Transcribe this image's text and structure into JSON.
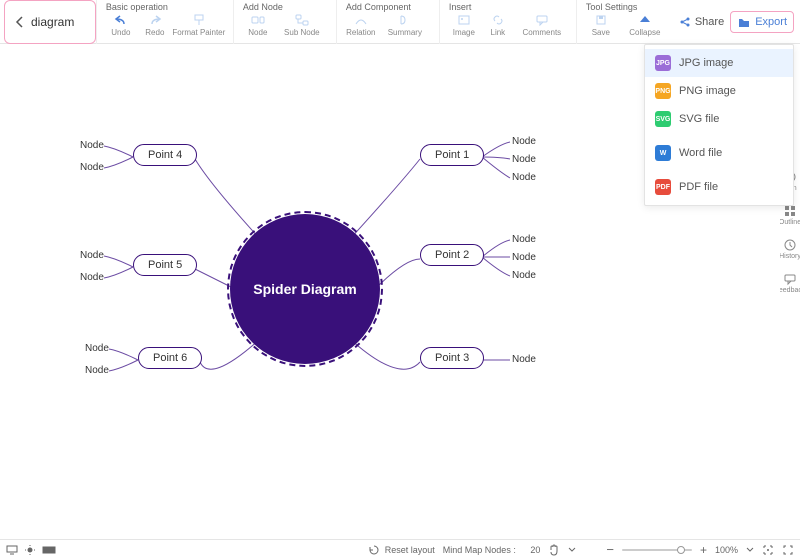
{
  "header": {
    "title": "diagram",
    "groups": {
      "basic": {
        "label": "Basic operation",
        "items": {
          "undo": "Undo",
          "redo": "Redo",
          "format": "Format Painter"
        }
      },
      "addNode": {
        "label": "Add Node",
        "items": {
          "node": "Node",
          "sub": "Sub Node"
        }
      },
      "addComp": {
        "label": "Add Component",
        "items": {
          "relation": "Relation",
          "summary": "Summary"
        }
      },
      "insert": {
        "label": "Insert",
        "items": {
          "image": "Image",
          "link": "Link",
          "comments": "Comments"
        }
      },
      "tool": {
        "label": "Tool Settings",
        "items": {
          "save": "Save",
          "collapse": "Collapse"
        }
      }
    },
    "share": "Share",
    "export": "Export"
  },
  "exportMenu": {
    "jpg": "JPG image",
    "png": "PNG image",
    "svg": "SVG file",
    "word": "Word file",
    "pdf": "PDF file"
  },
  "rail": {
    "icon": "Icon",
    "outline": "Outline",
    "history": "History",
    "feedback": "Feedback"
  },
  "diagram": {
    "center": "Spider Diagram",
    "p1": "Point 1",
    "p2": "Point 2",
    "p3": "Point 3",
    "p4": "Point 4",
    "p5": "Point 5",
    "p6": "Point 6",
    "leaf": "Node"
  },
  "status": {
    "reset": "Reset layout",
    "nodesLabel": "Mind Map Nodes :",
    "nodesCount": "20",
    "zoom": "100%"
  }
}
